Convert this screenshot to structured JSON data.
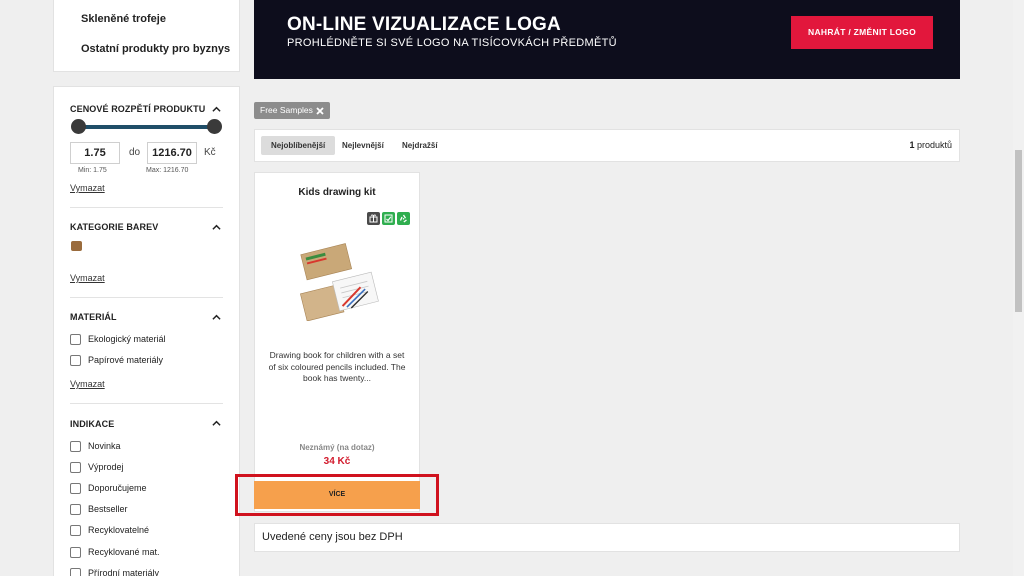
{
  "sidebar": {
    "links": [
      "Skleněné trofeje",
      "Ostatní produkty pro byznys"
    ]
  },
  "filters": {
    "price": {
      "title": "CENOVÉ ROZPĚTÍ PRODUKTU",
      "min_value": "1.75",
      "max_value": "1216.70",
      "separator": "do",
      "currency": "Kč",
      "min_hint": "Min: 1.75",
      "max_hint": "Max: 1216.70",
      "clear": "Vymazat"
    },
    "colors": {
      "title": "KATEGORIE BAREV",
      "swatch_color": "#9a6b3c",
      "clear": "Vymazat"
    },
    "material": {
      "title": "MATERIÁL",
      "options": [
        "Ekologický materiál",
        "Papírové materiály"
      ],
      "clear": "Vymazat"
    },
    "indication": {
      "title": "INDIKACE",
      "options": [
        "Novinka",
        "Výprodej",
        "Doporučujeme",
        "Bestseller",
        "Recyklovatelné",
        "Recyklované mat.",
        "Přírodní materiály"
      ]
    }
  },
  "banner": {
    "title": "ON-LINE VIZUALIZACE LOGA",
    "subtitle": "PROHLÉDNĚTE SI SVÉ LOGO NA TISÍCOVKÁCH PŘEDMĚTŮ",
    "button": "NAHRÁT / ZMĚNIT LOGO"
  },
  "active_filter": {
    "label": "Free Samples"
  },
  "sort": {
    "options": [
      "Nejoblíbenější",
      "Nejlevnější",
      "Nejdražší"
    ],
    "active": "Nejoblíbenější",
    "count_number": "1",
    "count_label": "produktů"
  },
  "product": {
    "title": "Kids drawing kit",
    "description": "Drawing book for children with a set of six coloured pencils included. The book has twenty...",
    "availability": "Neznámý (na dotaz)",
    "price": "34 Kč",
    "button": "VÍCE",
    "badges": [
      "gift-icon",
      "eco-icon",
      "recycle-icon"
    ]
  },
  "note": "Uvedené ceny jsou bez DPH",
  "colors": {
    "banner_bg": "#0d0d1c",
    "banner_button": "#e2173c",
    "more_button": "#f6a04c",
    "price": "#d21a2c",
    "highlight": "#d0121e",
    "slider": "#1f4e68"
  }
}
